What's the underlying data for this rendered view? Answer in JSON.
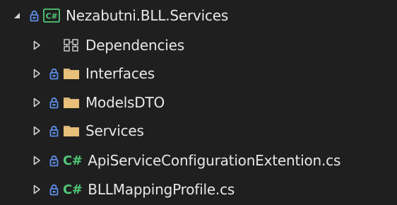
{
  "colors": {
    "background": "#1f1f1f",
    "text": "#e8e8e8",
    "lock": "#5f8fe8",
    "folder": "#dcb67a",
    "csharp_green": "#50c878",
    "chevron": "#d6d6d6"
  },
  "tree": {
    "project": {
      "label": "Nezabutni.BLL.Services",
      "expanded": true,
      "icon": "csharp-project-icon"
    },
    "items": [
      {
        "label": "Dependencies",
        "icon": "dependencies-icon",
        "type": "dependencies"
      },
      {
        "label": "Interfaces",
        "icon": "folder-icon",
        "type": "folder"
      },
      {
        "label": "ModelsDTO",
        "icon": "folder-icon",
        "type": "folder"
      },
      {
        "label": "Services",
        "icon": "folder-icon",
        "type": "folder"
      },
      {
        "label": "ApiServiceConfigurationExtention.cs",
        "icon": "csharp-file-icon",
        "type": "file",
        "badge": "C#"
      },
      {
        "label": "BLLMappingProfile.cs",
        "icon": "csharp-file-icon",
        "type": "file",
        "badge": "C#"
      }
    ]
  }
}
